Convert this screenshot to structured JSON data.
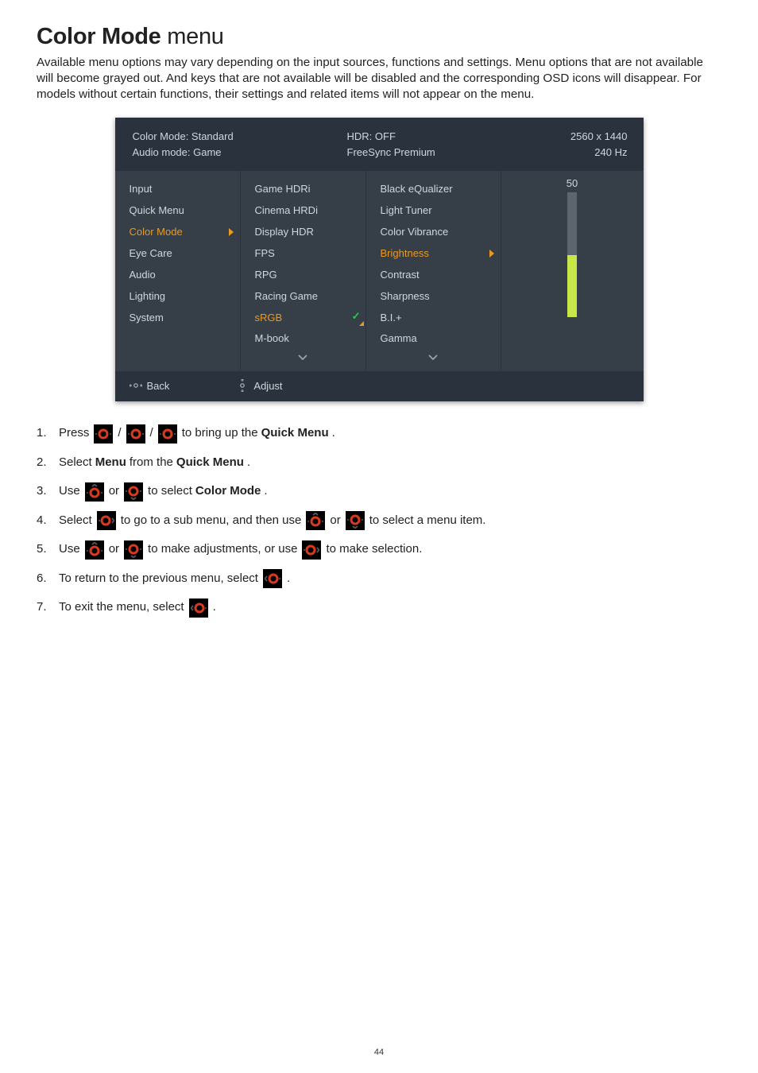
{
  "heading": {
    "bold": "Color Mode",
    "rest": " menu"
  },
  "intro": "Available menu options may vary depending on the input sources, functions and settings. Menu options that are not available will become grayed out. And keys that are not available will be disabled and the corresponding OSD icons will disappear. For models without certain functions, their settings and related items will not appear on the menu.",
  "osd": {
    "top": {
      "colorMode": "Color Mode: Standard",
      "audioMode": "Audio mode: Game",
      "hdr": "HDR: OFF",
      "freesync": "FreeSync Premium",
      "resolution": "2560 x 1440",
      "refresh": "240 Hz"
    },
    "nav": [
      "Input",
      "Quick Menu",
      "Color Mode",
      "Eye Care",
      "Audio",
      "Lighting",
      "System"
    ],
    "navSelectedIndex": 2,
    "sub1": [
      "Game HDRi",
      "Cinema HRDi",
      "Display HDR",
      "FPS",
      "RPG",
      "Racing Game",
      "sRGB",
      "M-book"
    ],
    "sub1SelectedIndex": 6,
    "sub2": [
      "Black eQualizer",
      "Light Tuner",
      "Color Vibrance",
      "Brightness",
      "Contrast",
      "Sharpness",
      "B.I.+",
      "Gamma"
    ],
    "sub2SelectedIndex": 3,
    "sliderValue": "50",
    "foot": {
      "back": "Back",
      "adjust": "Adjust"
    }
  },
  "steps": {
    "s1a": "Press ",
    "s1b": " / ",
    "s1c": " / ",
    "s1d": " to bring up the ",
    "s1bold": "Quick Menu",
    "s1e": ".",
    "s2a": "Select ",
    "s2bold1": "Menu",
    "s2b": " from the ",
    "s2bold2": "Quick Menu",
    "s2c": ".",
    "s3a": "Use ",
    "s3b": " or ",
    "s3c": " to select ",
    "s3bold": "Color Mode",
    "s3d": ".",
    "s4a": "Select ",
    "s4b": " to go to a sub menu, and then use ",
    "s4c": " or ",
    "s4d": " to select a menu item.",
    "s5a": "Use ",
    "s5b": " or ",
    "s5c": " to make adjustments, or use ",
    "s5d": " to make selection.",
    "s6a": "To return to the previous menu, select ",
    "s6b": ".",
    "s7a": "To exit the menu, select ",
    "s7b": "."
  },
  "pageNumber": "44"
}
